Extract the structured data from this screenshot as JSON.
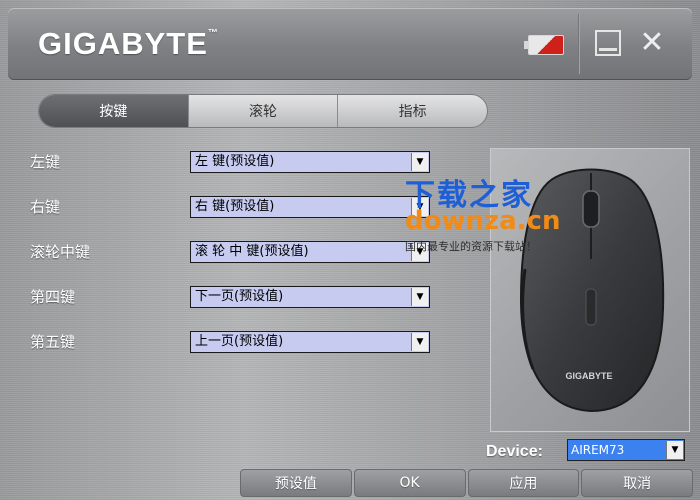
{
  "titlebar": {
    "logo": "GIGABYTE",
    "trademark": "™",
    "icons": {
      "battery": "battery-icon",
      "minimize": "minimize-icon",
      "close": "close-icon"
    }
  },
  "tabs": [
    {
      "label": "按键",
      "active": true
    },
    {
      "label": "滚轮",
      "active": false
    },
    {
      "label": "指标",
      "active": false
    }
  ],
  "button_settings": [
    {
      "label": "左键",
      "value": "左 键(预设值)"
    },
    {
      "label": "右键",
      "value": "右 键(预设值)"
    },
    {
      "label": "滚轮中键",
      "value": "滚 轮 中 键(预设值)"
    },
    {
      "label": "第四键",
      "value": "下一页(预设值)"
    },
    {
      "label": "第五键",
      "value": "上一页(预设值)"
    }
  ],
  "watermark": {
    "title": "下载之家",
    "site": "downza.cn",
    "tagline": "国内最专业的资源下载站！"
  },
  "device": {
    "label": "Device:",
    "value": "AIREM73"
  },
  "footer": {
    "default_label": "预设值",
    "ok_label": "OK",
    "apply_label": "应用",
    "cancel_label": "取消"
  },
  "colors": {
    "accent_select": "#c6cbef",
    "device_select": "#3b82f0",
    "battery_low": "#d0201a"
  }
}
